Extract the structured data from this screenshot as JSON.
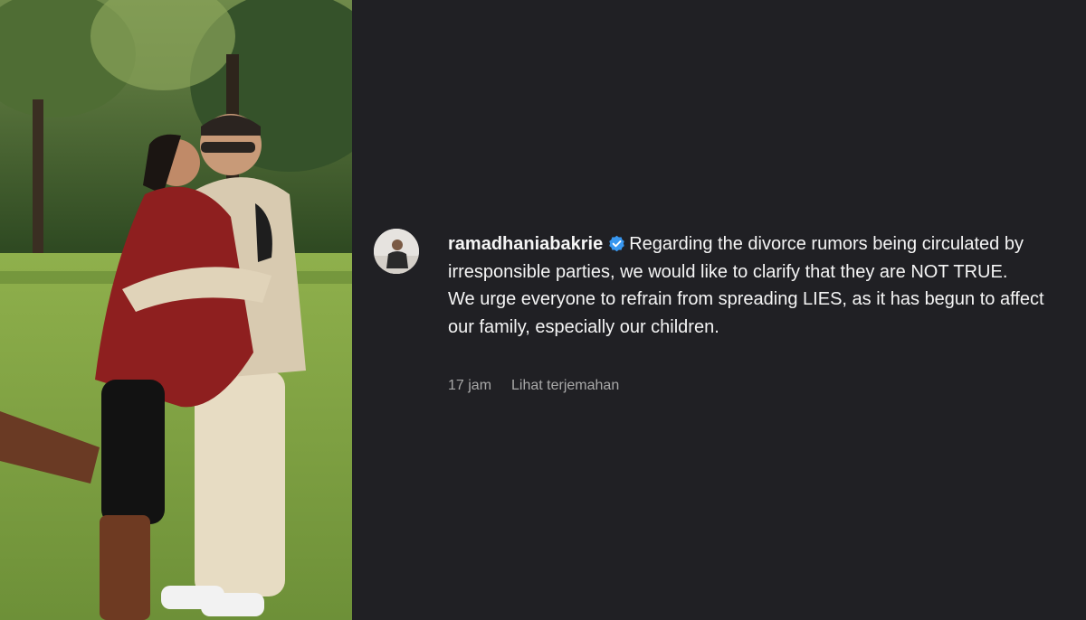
{
  "post": {
    "username": "ramadhaniabakrie",
    "verified": true,
    "verified_color": "#3897f0",
    "caption_line1": "Regarding the divorce rumors being circulated by irresponsible parties, we would like to clarify that they are NOT TRUE.",
    "caption_line2": "We urge everyone to refrain from spreading LIES, as it has begun to affect our family, especially our children.",
    "time_ago": "17 jam",
    "translate_label": "Lihat terjemahan"
  },
  "theme": {
    "background": "#202024",
    "text": "#f5f5f5",
    "muted": "#a8a8a8"
  }
}
